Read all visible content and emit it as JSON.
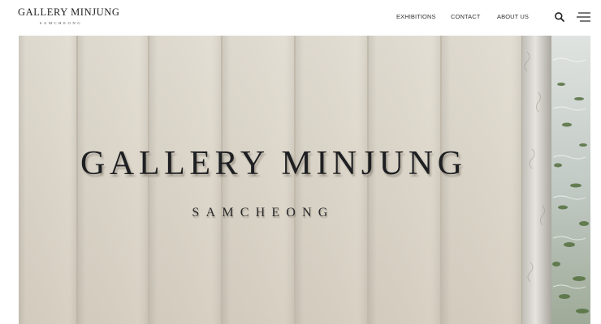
{
  "header": {
    "logo": {
      "main": "GALLERY MINJUNG",
      "sub": "SAMCHEONG"
    },
    "nav": [
      {
        "label": "EXHIBITIONS"
      },
      {
        "label": "CONTACT"
      },
      {
        "label": "ABOUT US"
      }
    ],
    "icons": {
      "search": "search-icon",
      "menu": "hamburger-menu-icon"
    }
  },
  "hero": {
    "sign_main": "GALLERY MINJUNG",
    "sign_sub": "SAMCHEONG",
    "colors": {
      "wall": "#ded8cc",
      "wall_shadow": "#c9c1b2",
      "lettering": "#1e1f22",
      "glass": "#b9c2c0",
      "foliage": "#4d6b3c"
    }
  }
}
